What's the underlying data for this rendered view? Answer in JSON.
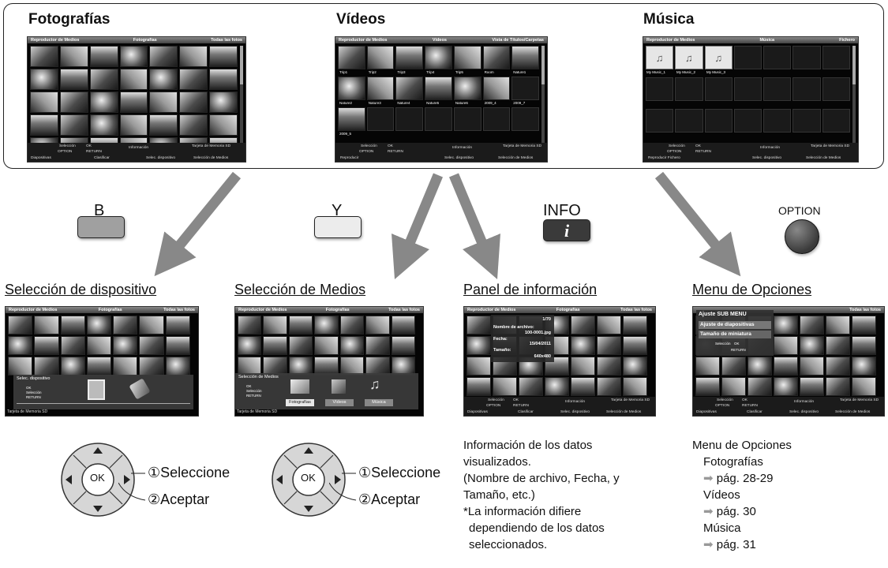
{
  "sections": {
    "photos_title": "Fotografías",
    "videos_title": "Vídeos",
    "music_title": "Música"
  },
  "photos_screen": {
    "head_left": "Reproductor de Medios",
    "head_mid": "Fotografías",
    "head_right": "Todas las fotos",
    "foot": {
      "select": "Selección",
      "ok": "OK",
      "option": "OPTION",
      "return": "RETURN",
      "info": "Información",
      "card": "Tarjeta de Memoria SD",
      "slides": "Diapositivas",
      "sort": "Clasificar",
      "device": "Selec. dispositivo",
      "media": "Selección de Medios"
    }
  },
  "videos_screen": {
    "head_left": "Reproductor de Medios",
    "head_mid": "Vídeos",
    "head_right": "Vista de Títulos/Carpetas",
    "captions": [
      "Trip1",
      "Trip2",
      "Trip3",
      "Trip4",
      "Trip5",
      "Room",
      "Nature1",
      "Nature2",
      "Nature3",
      "Nature4",
      "Nature5",
      "Nature6",
      "2009_4",
      "2009_7",
      "2009_5"
    ],
    "foot": {
      "select": "Selección",
      "ok": "OK",
      "option": "OPTION",
      "return": "RETURN",
      "info": "Información",
      "card": "Tarjeta de Memoria SD",
      "play": "Reproducir",
      "device": "Selec. dispositivo",
      "media": "Selección de Medios"
    }
  },
  "music_screen": {
    "head_left": "Reproductor de Medios",
    "head_mid": "Música",
    "head_right": "Fichero",
    "captions": [
      "My Music_1",
      "My Music_2",
      "My Music_3"
    ],
    "foot": {
      "select": "Selección",
      "ok": "OK",
      "option": "OPTION",
      "return": "RETURN",
      "info": "Información",
      "card": "Tarjeta de Memoria SD",
      "play_file": "Reproducir Fichero",
      "device": "Selec. dispositivo",
      "media": "Selección de Medios"
    }
  },
  "keys": {
    "b": "B",
    "y": "Y",
    "info": "INFO",
    "info_glyph": "i",
    "option": "OPTION",
    "b_color": "#a0a0a0",
    "y_color": "#ececec",
    "info_color": "#3a3a3a"
  },
  "headings": {
    "device": "Selección de dispositivo",
    "media": "Selección de Medios",
    "info": "Panel de información",
    "options": "Menu de Opciones"
  },
  "device_screen": {
    "panel_title": "Selec. dispositivo",
    "ok": "OK",
    "select": "Selección",
    "return": "RETURN",
    "card": "Tarjeta de Memoria SD"
  },
  "media_screen": {
    "panel_title": "Selección de Medios",
    "ok": "OK",
    "select": "Selección",
    "return": "RETURN",
    "tabs": [
      "Fotografías",
      "Vídeos",
      "Música"
    ],
    "card": "Tarjeta de Memoria SD"
  },
  "info_screen": {
    "counter": "1/70",
    "filename_label": "Nombre de archivo:",
    "filename": "100-0001.jpg",
    "date_label": "Fecha:",
    "date": "15/04/2011",
    "size_label": "Tamaño:",
    "size": "640x480"
  },
  "options_screen": {
    "menu_title": "Ajuste SUB MENU",
    "items": [
      "Ajuste de diapositivas",
      "Tamaño de miniatura"
    ],
    "select": "Selección",
    "ok": "OK",
    "return": "RETURN"
  },
  "dpad": {
    "ok": "OK",
    "step1": "①Seleccione",
    "step2": "②Aceptar"
  },
  "info_text": {
    "l1": "Información de los datos",
    "l2": "visualizados.",
    "l3": "(Nombre de archivo, Fecha, y",
    "l4": "Tamaño, etc.)",
    "l5": "*La información difiere",
    "l6": "dependiendo de los datos",
    "l7": "seleccionados."
  },
  "options_text": {
    "title": "Menu de Opciones",
    "photos": "Fotografías",
    "photos_page": "pág. 28-29",
    "videos": "Vídeos",
    "videos_page": "pág. 30",
    "music": "Música",
    "music_page": "pág. 31",
    "arrow": "➡"
  }
}
